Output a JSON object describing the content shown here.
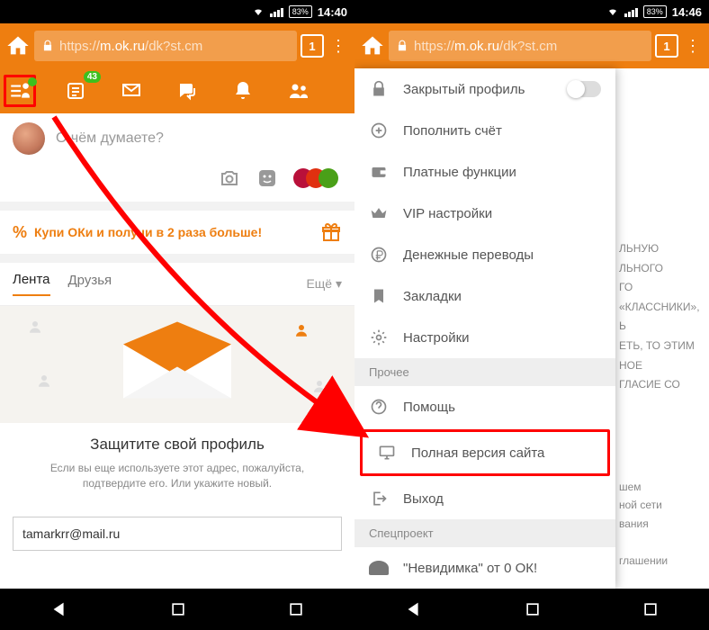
{
  "statusbar": {
    "battery": "83%",
    "time_left": "14:40",
    "time_right": "14:46"
  },
  "browser": {
    "url_prefix": "https://",
    "url_host": "m.ok.ru",
    "url_path": "/dk?st.cm",
    "tab_count": "1"
  },
  "toolbar": {
    "feed_badge": "43"
  },
  "compose": {
    "placeholder": "О чём думаете?"
  },
  "promo": {
    "text": "Купи ОКи и получи в 2 раза больше!"
  },
  "tabs": {
    "lenta": "Лента",
    "druzya": "Друзья",
    "more": "Ещё ▾"
  },
  "protect": {
    "title": "Защитите свой профиль",
    "desc": "Если вы еще используете этот адрес, пожалуйста, подтвердите его. Или укажите новый.",
    "email": "tamarkrr@mail.ru"
  },
  "drawer": {
    "private_profile": "Закрытый профиль",
    "topup": "Пополнить счёт",
    "paid": "Платные функции",
    "vip": "VIP настройки",
    "transfers": "Денежные переводы",
    "bookmarks": "Закладки",
    "settings": "Настройки",
    "section_other": "Прочее",
    "help": "Помощь",
    "fullsite": "Полная версия сайта",
    "exit": "Выход",
    "section_spec": "Спецпроект",
    "invisible": "\"Невидимка\" от 0 ОК!"
  },
  "bg_text_upper": "ЛЬНУЮ\nЛЬНОГО\nГО\n«КЛАССНИКИ»,\nЬ\nЕТЬ, ТО ЭТИМ\nНОЕ\nГЛАСИЕ СО",
  "bg_text_lower": "шем\nной сети\nвания\n\nглашении"
}
